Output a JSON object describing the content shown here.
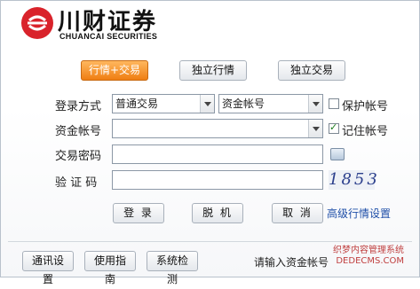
{
  "brand": {
    "name_cn": "川财证券",
    "name_en": "CHUANCAI SECURITIES"
  },
  "tabs": [
    {
      "label": "行情+交易",
      "active": true
    },
    {
      "label": "独立行情",
      "active": false
    },
    {
      "label": "独立交易",
      "active": false
    }
  ],
  "form": {
    "login_mode_label": "登录方式",
    "login_mode_value": "普通交易",
    "account_type_value": "资金帐号",
    "protect_account_label": "保护帐号",
    "protect_account_checked": false,
    "account_label": "资金帐号",
    "account_value": "",
    "remember_account_label": "记住帐号",
    "remember_account_checked": true,
    "password_label": "交易密码",
    "captcha_label": "验 证 码",
    "captcha_value": "1853"
  },
  "actions": {
    "login": "登 录",
    "offline": "脱 机",
    "cancel": "取 消",
    "advanced": "高级行情设置"
  },
  "bottom": {
    "comm_settings": "通讯设置",
    "guide": "使用指南",
    "system_check": "系统检测",
    "status_text": "请输入资金帐号"
  },
  "watermark": {
    "line1": "织梦内容管理系统",
    "line2": "DEDECMS.COM"
  },
  "colors": {
    "accent": "#ef7e12",
    "brand_red": "#d9232b",
    "link": "#1f4fa8"
  }
}
